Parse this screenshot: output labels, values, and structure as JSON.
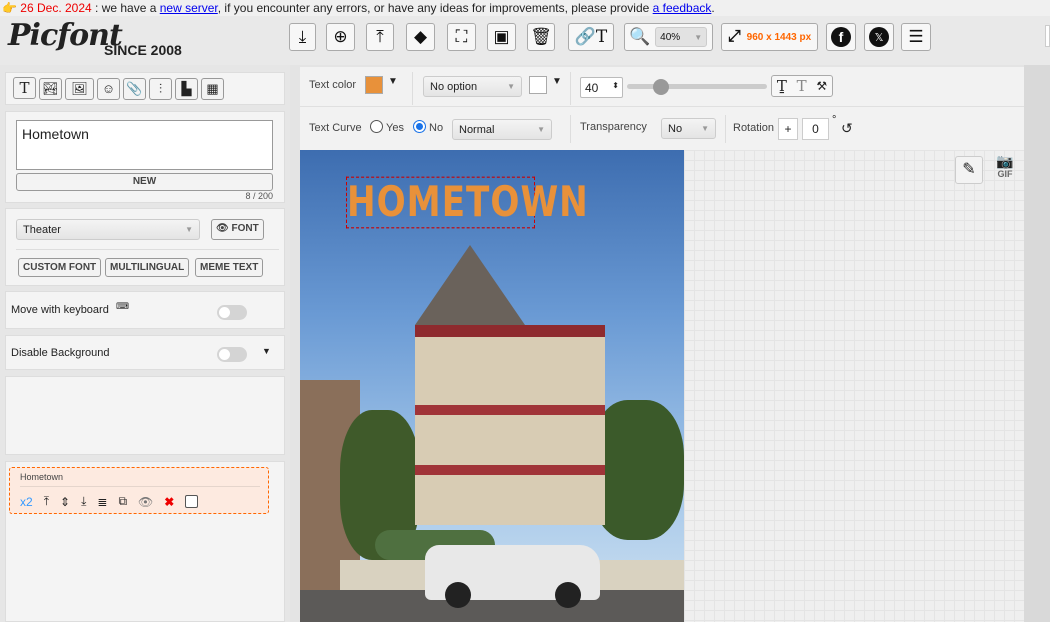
{
  "notice": {
    "date": "26 Dec. 2024",
    "text1": " : we have a ",
    "link1": "new server",
    "text2": ", if you encounter any errors, or have any ideas for improvements, please provide ",
    "link2": "a feedback",
    "text3": "."
  },
  "header": {
    "logo": "Picfont",
    "since": "SINCE 2008",
    "zoom": "40%",
    "dimensions": "960 x 1443 px",
    "link_text_icon": "T"
  },
  "left": {
    "text_value": "Hometown",
    "new_label": "NEW",
    "char_count": "8 / 200",
    "font_select": "Theater",
    "font_button": "FONT",
    "custom_font": "CUSTOM FONT",
    "multilingual": "MULTILINGUAL",
    "meme_text": "MEME TEXT",
    "move_keyboard": "Move with keyboard",
    "disable_background": "Disable Background",
    "layer": {
      "name": "Hometown",
      "x2": "x2"
    }
  },
  "toolbar": {
    "text_color_label": "Text color",
    "text_color": "#e8913a",
    "option_select": "No option",
    "font_size": "40",
    "text_curve_label": "Text Curve",
    "yes": "Yes",
    "no": "No",
    "curve_select": "Normal",
    "transparency_label": "Transparency",
    "transparency_select": "No",
    "rotation_label": "Rotation",
    "rotation_plus": "+",
    "rotation_value": "0",
    "degree": "°"
  },
  "canvas": {
    "overlay_text": "HOMETOWN",
    "gif_label": "GIF"
  }
}
